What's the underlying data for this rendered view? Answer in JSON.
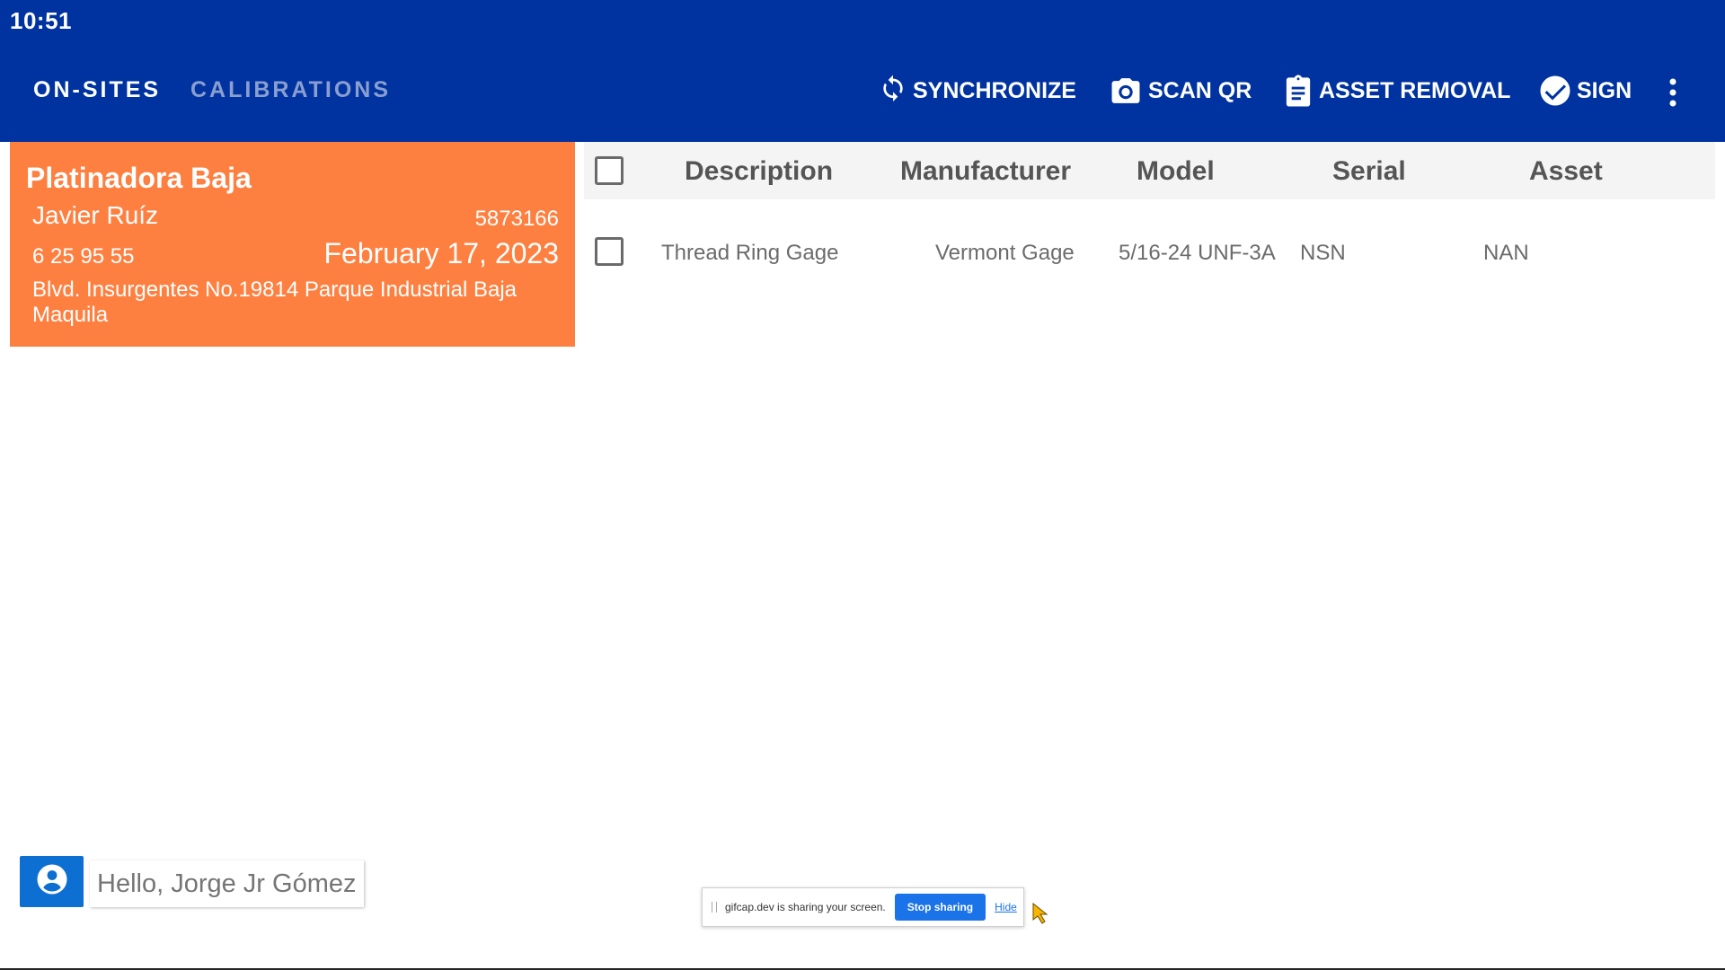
{
  "status_bar": {
    "time": "10:51"
  },
  "tabs": [
    {
      "label": "ON-SITES",
      "active": true
    },
    {
      "label": "CALIBRATIONS",
      "active": false
    }
  ],
  "actions": {
    "synchronize": {
      "label": "SYNCHRONIZE",
      "icon": "sync-icon"
    },
    "scan_qr": {
      "label": "SCAN QR",
      "icon": "camera-icon"
    },
    "asset_removal": {
      "label": "ASSET REMOVAL",
      "icon": "clipboard-icon"
    },
    "sign": {
      "label": "SIGN",
      "icon": "check-circle-icon"
    },
    "more": {
      "icon": "more-vert-icon"
    }
  },
  "site_card": {
    "company": "Platinadora Baja",
    "contact": "Javier Ruíz",
    "number": "5873166",
    "phone": "6 25 95 55",
    "date": "February 17, 2023",
    "address": "Blvd. Insurgentes No.19814 Parque Industrial Baja Maquila"
  },
  "table": {
    "columns": [
      "Description",
      "Manufacturer",
      "Model",
      "Serial",
      "Asset"
    ],
    "rows": [
      {
        "description": "Thread Ring Gage",
        "manufacturer": "Vermont Gage",
        "model": "5/16-24 UNF-3A",
        "serial": "NSN",
        "asset": "NAN",
        "checked": false
      }
    ]
  },
  "footer": {
    "greeting": "Hello, Jorge Jr Gómez",
    "user_icon": "account-circle-icon"
  },
  "screen_share": {
    "message": "gifcap.dev is sharing your screen.",
    "stop_label": "Stop sharing",
    "hide_label": "Hide"
  },
  "colors": {
    "app_bar": "#0033a0",
    "card": "#fe8041",
    "accent": "#0d6fd1"
  }
}
